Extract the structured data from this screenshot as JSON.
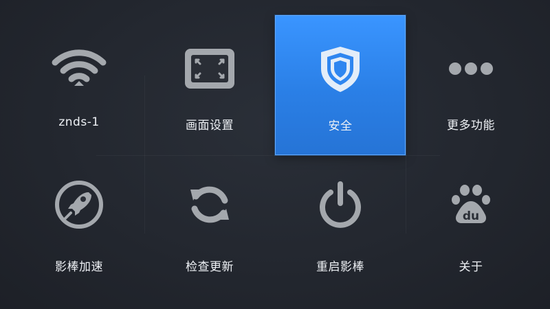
{
  "menu": {
    "items": [
      {
        "label": "znds-1",
        "icon": "wifi-icon"
      },
      {
        "label": "画面设置",
        "icon": "screen-frame-icon"
      },
      {
        "label": "安全",
        "icon": "shield-icon",
        "selected": true
      },
      {
        "label": "更多功能",
        "icon": "more-dots-icon"
      },
      {
        "label": "影棒加速",
        "icon": "rocket-icon"
      },
      {
        "label": "检查更新",
        "icon": "refresh-icon"
      },
      {
        "label": "重启影棒",
        "icon": "power-icon"
      },
      {
        "label": "关于",
        "icon": "baidu-paw-icon"
      }
    ]
  },
  "colors": {
    "background": "#23272f",
    "icon_gray": "#a4a8ad",
    "selected_tile": "#2f86f0",
    "text": "#eef1f5"
  }
}
